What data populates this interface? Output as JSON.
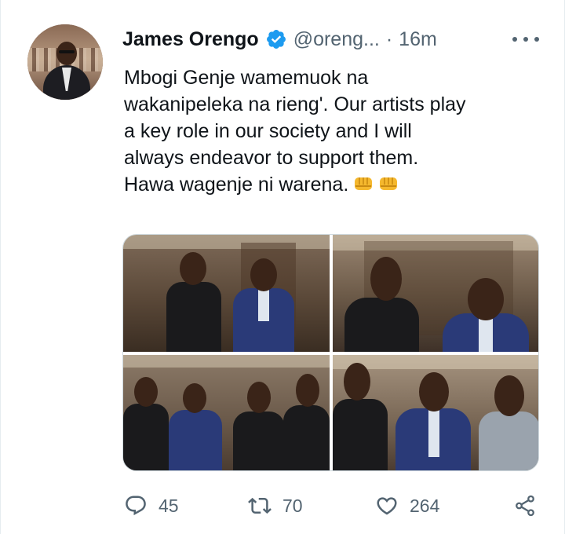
{
  "tweet": {
    "author_name": "James Orengo",
    "handle": "@oreng...",
    "separator": "·",
    "time": "16m",
    "text_lines": [
      "Mbogi Genje wamemuok na",
      "wakanipeleka na rieng'. Our artists play",
      "a key role in our society and I will",
      "always endeavor to support them.",
      "Hawa wagenje ni warena."
    ],
    "emoji": [
      "oncoming-fist",
      "oncoming-fist"
    ],
    "media_count": 4
  },
  "actions": {
    "reply_count": "45",
    "retweet_count": "70",
    "like_count": "264"
  },
  "icons": {
    "verified": "verified-badge-icon",
    "more": "more-options-icon",
    "reply": "reply-icon",
    "retweet": "retweet-icon",
    "like": "heart-icon",
    "share": "share-icon"
  },
  "colors": {
    "verified_blue": "#1d9bf0",
    "secondary_text": "#536471",
    "primary_text": "#0f1419",
    "fist_emoji": "#f5b82e"
  }
}
